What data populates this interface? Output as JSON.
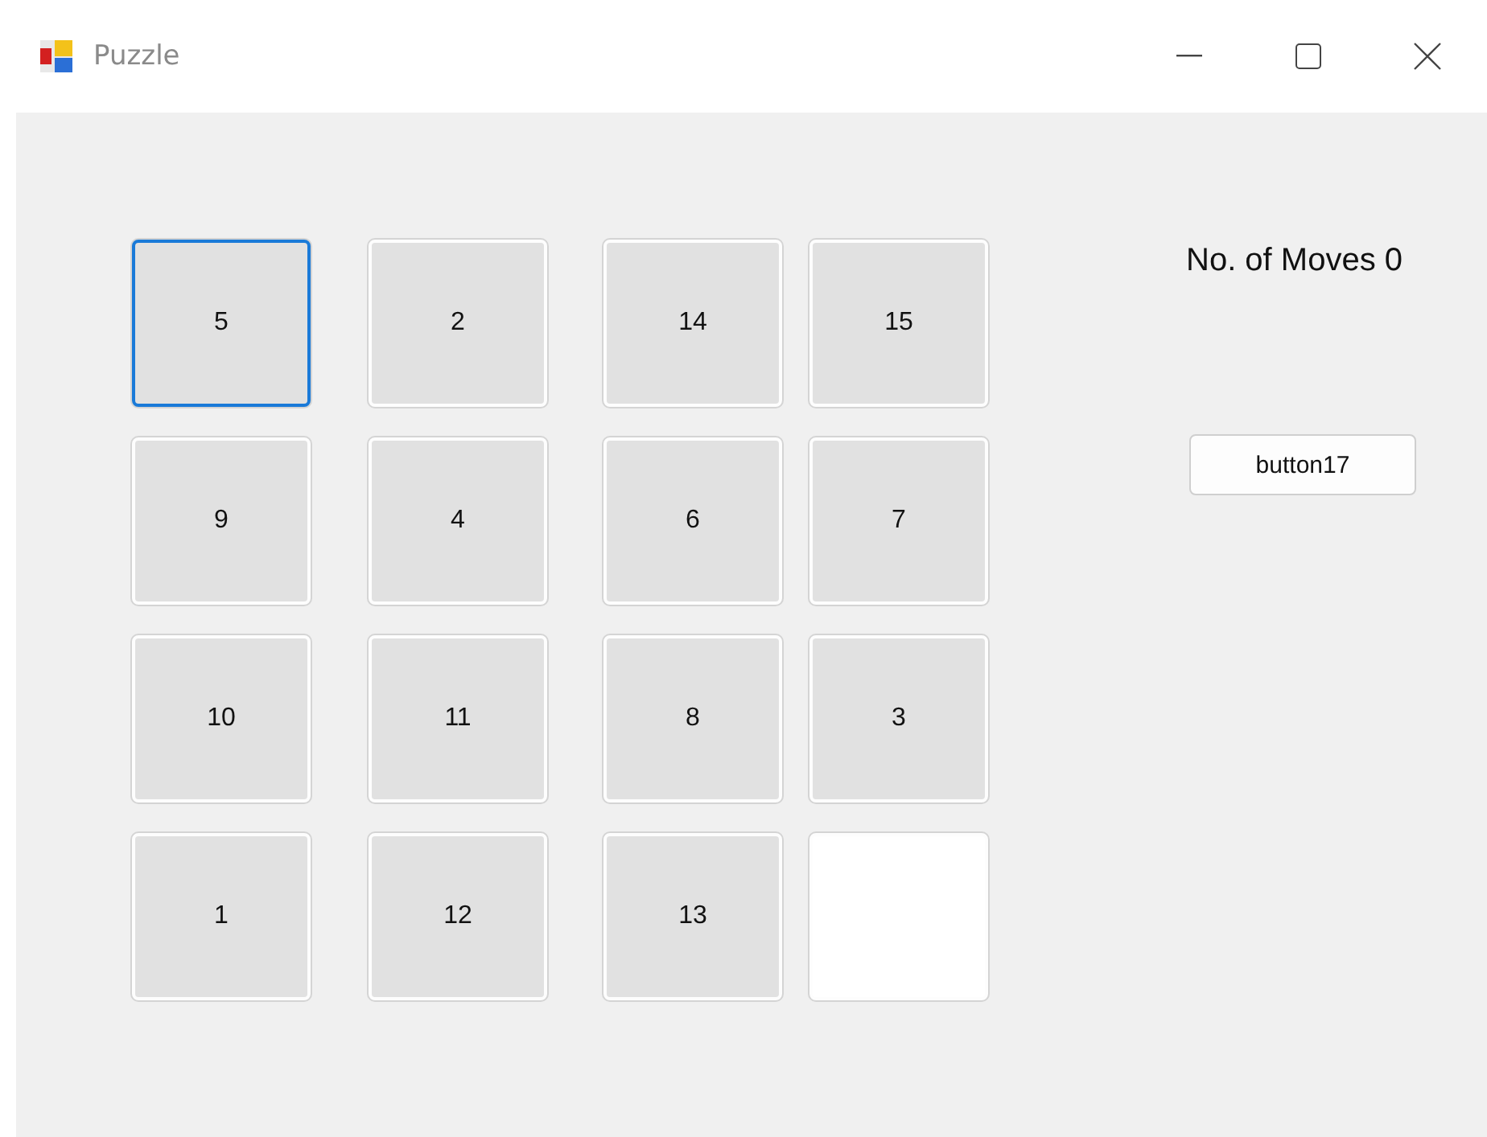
{
  "window": {
    "title": "Puzzle"
  },
  "tiles": [
    {
      "kind": "tile",
      "label": "5",
      "focused": true
    },
    {
      "kind": "tile",
      "label": "2",
      "focused": false
    },
    {
      "kind": "tile",
      "label": "14",
      "focused": false
    },
    {
      "kind": "tile",
      "label": "15",
      "focused": false
    },
    {
      "kind": "tile",
      "label": "9",
      "focused": false
    },
    {
      "kind": "tile",
      "label": "4",
      "focused": false
    },
    {
      "kind": "tile",
      "label": "6",
      "focused": false
    },
    {
      "kind": "tile",
      "label": "7",
      "focused": false
    },
    {
      "kind": "tile",
      "label": "10",
      "focused": false
    },
    {
      "kind": "tile",
      "label": "11",
      "focused": false
    },
    {
      "kind": "tile",
      "label": "8",
      "focused": false
    },
    {
      "kind": "tile",
      "label": "3",
      "focused": false
    },
    {
      "kind": "tile",
      "label": "1",
      "focused": false
    },
    {
      "kind": "tile",
      "label": "12",
      "focused": false
    },
    {
      "kind": "tile",
      "label": "13",
      "focused": false
    },
    {
      "kind": "blank",
      "focused": false
    }
  ],
  "moves_label": "No. of Moves 0",
  "button": "button17"
}
